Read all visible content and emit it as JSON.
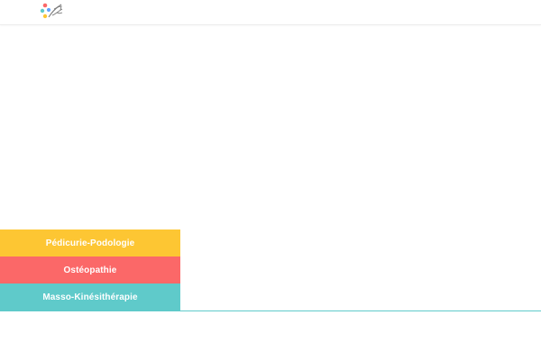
{
  "colors": {
    "yellow": "#fdc633",
    "red": "#fb6868",
    "teal": "#5fcaca",
    "logo_accent": "#7d7d7d"
  },
  "header": {
    "logo_icon": "multicolor-dots-logo-icon"
  },
  "services": [
    {
      "label": "Pédicurie-Podologie"
    },
    {
      "label": "Ostéopathie"
    },
    {
      "label": "Masso-Kinésithérapie"
    }
  ]
}
